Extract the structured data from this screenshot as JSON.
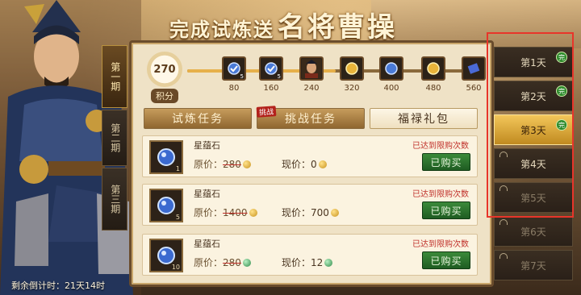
{
  "title": {
    "part1": "完成试炼送",
    "part2": "名将曹操"
  },
  "periods": [
    "第一期",
    "第二期",
    "第三期"
  ],
  "points": {
    "value": "270",
    "label": "积分"
  },
  "progress_fraction": 0.5,
  "rewards": [
    {
      "value": "80",
      "count": "5",
      "icon": "gem-icon"
    },
    {
      "value": "160",
      "count": "5",
      "icon": "gem-icon"
    },
    {
      "value": "240",
      "count": "",
      "icon": "hero-portrait-icon"
    },
    {
      "value": "320",
      "count": "",
      "icon": "coin-icon"
    },
    {
      "value": "400",
      "count": "",
      "icon": "gem-icon"
    },
    {
      "value": "480",
      "count": "",
      "icon": "coin-icon"
    },
    {
      "value": "560",
      "count": "",
      "icon": "scroll-icon"
    }
  ],
  "tabs": {
    "trial": "试炼任务",
    "challenge": "挑战任务",
    "gift": "福禄礼包",
    "badge": "挑战"
  },
  "items": [
    {
      "name": "星蕴石",
      "qty": "1",
      "orig_label": "原价：",
      "orig": "280",
      "now_label": "现价：",
      "now": "0",
      "limit": "已达到限购次数",
      "button": "已购买",
      "currency": "gold"
    },
    {
      "name": "星蕴石",
      "qty": "5",
      "orig_label": "原价：",
      "orig": "1400",
      "now_label": "现价：",
      "now": "700",
      "limit": "已达到限购次数",
      "button": "已购买",
      "currency": "gold"
    },
    {
      "name": "星蕴石",
      "qty": "10",
      "orig_label": "原价：",
      "orig": "280",
      "now_label": "现价：",
      "now": "12",
      "limit": "已达到限购次数",
      "button": "已购买",
      "currency": "green"
    }
  ],
  "days": [
    {
      "label": "第1天",
      "status": "done"
    },
    {
      "label": "第2天",
      "status": "done"
    },
    {
      "label": "第3天",
      "status": "selected-done"
    },
    {
      "label": "第4天",
      "status": "locked"
    },
    {
      "label": "第5天",
      "status": "locked"
    },
    {
      "label": "第6天",
      "status": "locked"
    },
    {
      "label": "第7天",
      "status": "locked"
    }
  ],
  "done_mark": "完",
  "countdown": "剩余倒计时：21天14时",
  "colors": {
    "accent_gold": "#f3c65a",
    "highlight_red": "#e8352a",
    "buy_green": "#2f7d31",
    "limit_red": "#c0302a"
  }
}
